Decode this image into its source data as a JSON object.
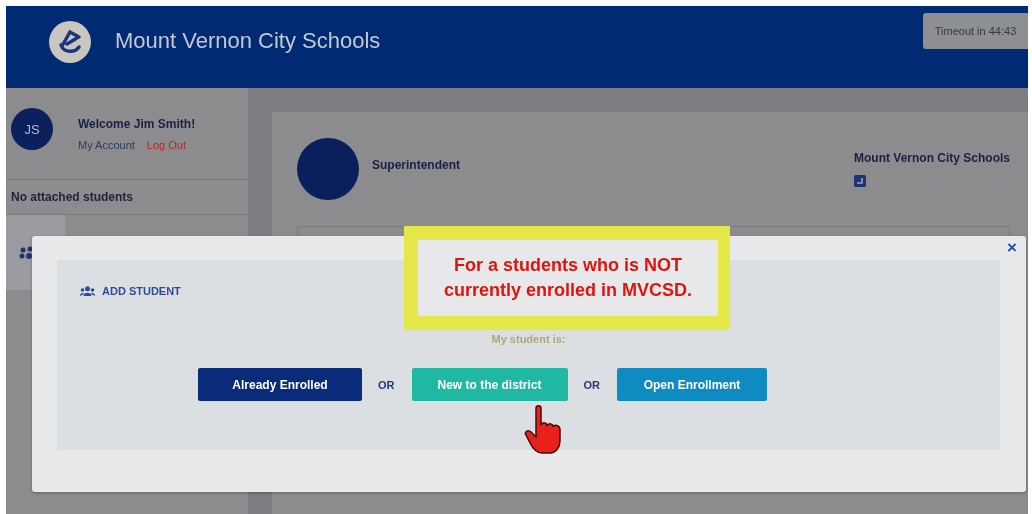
{
  "header": {
    "title": "Mount Vernon City Schools",
    "timeout": "Timeout in 44:43"
  },
  "sidebar": {
    "avatar": "JS",
    "welcome": "Welcome Jim Smith!",
    "links": [
      {
        "label": "My Account",
        "kind": "normal"
      },
      {
        "label": "Log Out",
        "kind": "danger"
      }
    ],
    "students_note": "No attached students"
  },
  "card": {
    "role": "Superintendent",
    "district": "Mount Vernon City Schools"
  },
  "modal": {
    "close": "×",
    "heading": "ADD STUDENT",
    "prompt": "My student is:",
    "options": [
      {
        "kind": "button",
        "label": "Already Enrolled",
        "color": "#0a2a7a"
      },
      {
        "kind": "separator",
        "label": "OR"
      },
      {
        "kind": "button",
        "label": "New to the district",
        "color": "#1fb9a3"
      },
      {
        "kind": "separator",
        "label": "OR"
      },
      {
        "kind": "button",
        "label": "Open Enrollment",
        "color": "#0e8bc0"
      }
    ]
  },
  "callout": {
    "text": "For a students who is NOT currently enrolled in MVCSD."
  }
}
